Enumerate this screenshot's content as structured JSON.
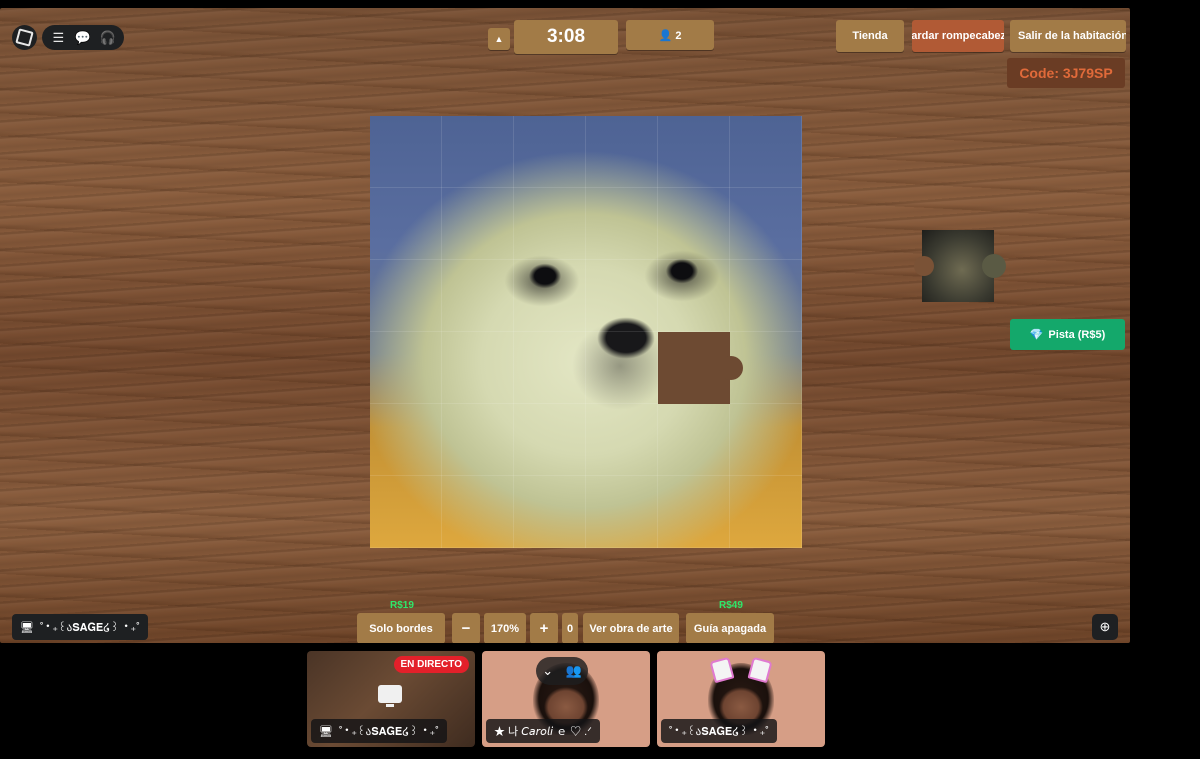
{
  "topbar": {
    "timer": "3:08",
    "players": "👤 2",
    "tienda": "Tienda",
    "guardar": "Guardar rompecabezas",
    "salir": "Salir de la habitación",
    "code": "Code: 3J79SP"
  },
  "icons": {
    "roblox": "roblox-logo-icon",
    "menu": "☰",
    "chat": "💬",
    "headset": "🎧",
    "up": "▲",
    "gem": "💎",
    "zoom": "⊕",
    "screen": "🖥"
  },
  "hint": {
    "label": "Pista (R$5)"
  },
  "controls": {
    "price_bordes": "R$19",
    "price_guia": "R$49",
    "solo_bordes": "Solo bordes",
    "minus": "−",
    "zoom": "170%",
    "plus": "+",
    "zero": "0",
    "ver_obra": "Ver obra de arte",
    "guia": "Guía apagada"
  },
  "user": {
    "name": "˚‧₊꒰ა𝐒𝐀𝐆𝐄໒꒱ ‧₊˚"
  },
  "call": {
    "live": "EN DIRECTO",
    "tile1_name": "˚‧₊꒰ა𝐒𝐀𝐆𝐄໒꒱ ‧₊˚",
    "tile2_name": "★ 나 𝘊𝘢𝘳𝘰𝘭𝘪 ｅ ♡ .ᐟ",
    "tile3_name": "˚‧₊꒰ა𝐒𝐀𝐆𝐄໒꒱ ‧₊˚",
    "collapse": "⌄",
    "people": "👥"
  },
  "colors": {
    "button": "#a27b47",
    "hint": "#14a86b",
    "code_text": "#e06a3a",
    "live": "#e3202a",
    "price": "#2ee86a"
  }
}
